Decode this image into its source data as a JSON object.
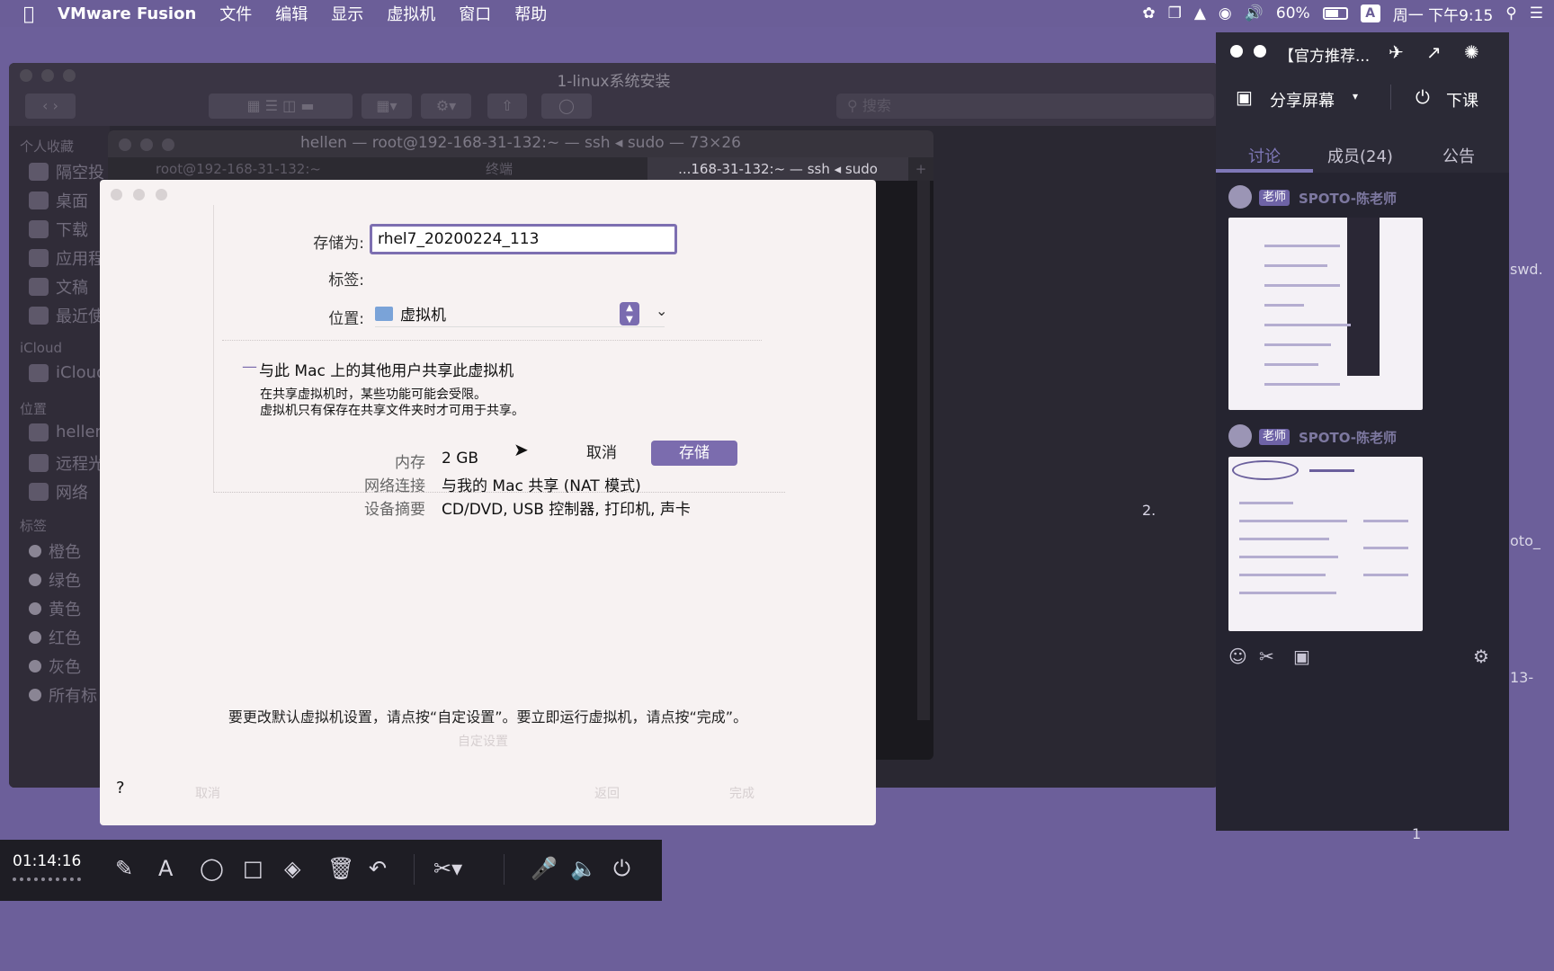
{
  "menubar": {
    "app_name": "VMware Fusion",
    "items": [
      "文件",
      "编辑",
      "显示",
      "虚拟机",
      "窗口",
      "帮助"
    ],
    "battery_percent": "60%",
    "input_method": "A",
    "clock": "周一 下午9:15"
  },
  "finder": {
    "title": "1-linux系统安装",
    "search_placeholder": "搜索",
    "sidebar": {
      "favorites_header": "个人收藏",
      "favorites": [
        "隔空投",
        "桌面",
        "下载",
        "应用程",
        "文稿",
        "最近使"
      ],
      "icloud_header": "iCloud",
      "icloud_items": [
        "iCloud"
      ],
      "locations_header": "位置",
      "locations": [
        "hellen",
        "远程光",
        "网络"
      ],
      "tags_header": "标签",
      "tags": [
        "橙色",
        "绿色",
        "黄色",
        "红色",
        "灰色",
        "所有标"
      ]
    }
  },
  "terminal": {
    "title": "hellen — root@192-168-31-132:~ — ssh ◂ sudo — 73×26",
    "tabs": [
      "root@192-168-31-132:~",
      "终端",
      "...168-31-132:~ — ssh ◂ sudo"
    ]
  },
  "dialog": {
    "save_as_label": "存储为:",
    "save_as_value": "rhel7_20200224_113",
    "tags_label": "标签:",
    "location_label": "位置:",
    "location_value": "虚拟机",
    "share_title": "与此 Mac 上的其他用户共享此虚拟机",
    "share_note_1": "在共享虚拟机时，某些功能可能会受限。",
    "share_note_2": "虚拟机只有保存在共享文件夹时才可用于共享。",
    "cancel_label": "取消",
    "save_label": "存储",
    "summary": [
      {
        "key": "内存",
        "value": "2 GB"
      },
      {
        "key": "网络连接",
        "value": "与我的 Mac 共享 (NAT 模式)"
      },
      {
        "key": "设备摘要",
        "value": "CD/DVD, USB 控制器, 打印机, 声卡"
      }
    ],
    "hint": "要更改默认虚拟机设置，请点按“自定设置”。要立即运行虚拟机，请点按“完成”。",
    "faint_customize": "自定设置",
    "help_label": "?",
    "faint_cancel": "取消",
    "faint_back": "返回",
    "faint_done": "完成"
  },
  "panel": {
    "title": "【官方推荐...",
    "share_screen": "分享屏幕",
    "end_class": "下课",
    "tabs": [
      "讨论",
      "成员(24)",
      "公告"
    ],
    "messages": [
      {
        "badge": "老师",
        "name": "SPOTO-陈老师"
      },
      {
        "badge": "老师",
        "name": "SPOTO-陈老师"
      }
    ]
  },
  "bottombar": {
    "timer": "01:14:16"
  },
  "background_fragments": [
    "swd.",
    "oto_",
    "13-",
    "2.",
    "1"
  ]
}
